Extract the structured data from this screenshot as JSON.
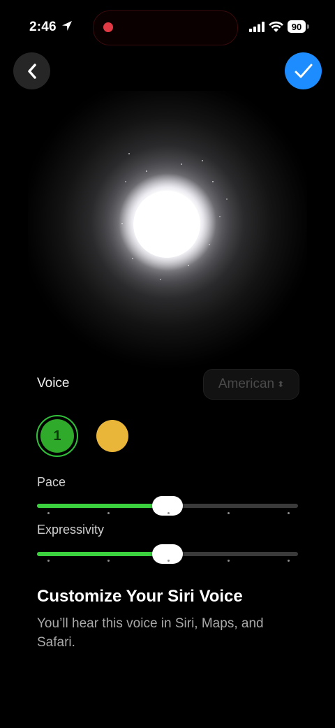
{
  "status_bar": {
    "time": "2:46",
    "battery": "90",
    "icons": [
      "location-arrow-icon",
      "recording-dot-icon",
      "signal-icon",
      "wifi-icon",
      "battery-icon"
    ]
  },
  "nav": {
    "back_icon": "chevron-left-icon",
    "done_icon": "checkmark-icon",
    "done_color": "#1c8cff"
  },
  "voice": {
    "label": "Voice",
    "accent_value": "American",
    "accent_icon": "chevron-up-down-icon",
    "options": [
      {
        "label": "1",
        "color": "#2faa2b",
        "selected": true
      },
      {
        "label": "",
        "color": "#e9b63a",
        "selected": false
      }
    ]
  },
  "sliders": {
    "pace": {
      "label": "Pace",
      "value": 0.5
    },
    "expressivity": {
      "label": "Expressivity",
      "value": 0.5
    }
  },
  "info": {
    "title": "Customize Your Siri Voice",
    "description": "You’ll hear this voice in Siri, Maps, and Safari."
  },
  "colors": {
    "accent_green": "#3ad03e",
    "background": "#000000"
  }
}
